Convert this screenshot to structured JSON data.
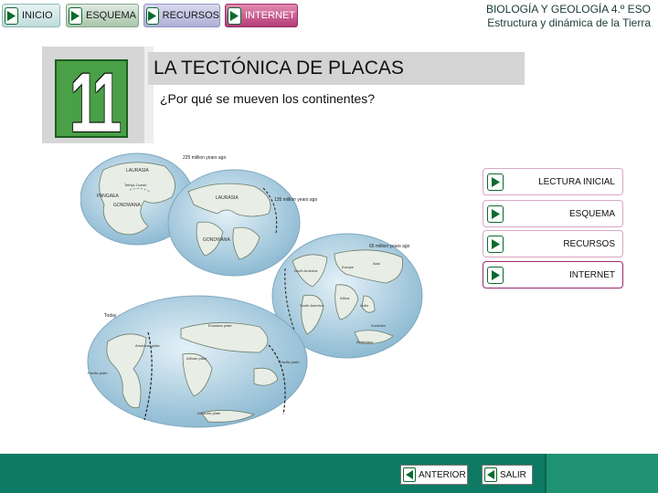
{
  "topnav": {
    "inicio": "INICIO",
    "esquema": "ESQUEMA",
    "recursos": "RECURSOS",
    "internet": "INTERNET"
  },
  "header": {
    "line1": "BIOLOGÍA Y GEOLOGÍA 4.º ESO",
    "line2": "Estructura y dinámica de la Tierra"
  },
  "chapter": {
    "number": "11"
  },
  "main": {
    "title": "LA TECTÓNICA DE PLACAS",
    "subtitle": "¿Por qué se mueven los continentes?"
  },
  "figure": {
    "labels": {
      "t1": "225 million years ago",
      "t2": "135 million years ago",
      "t3": "65 million years ago",
      "t4": "Today",
      "laurasia": "LAURASIA",
      "gondwana": "GONDWANA",
      "pangaea": "PANGAEA",
      "tethys": "Tethys Ocean",
      "north_america": "North America",
      "south_america": "South America",
      "europe": "Europe",
      "asia": "Asia",
      "africa": "Africa",
      "india": "India",
      "australia": "Australia",
      "antarctica": "Antarctica",
      "eurasian": "Eurasian plate",
      "american": "American plate",
      "african": "African plate",
      "pacific_left": "Pacific plate",
      "pacific_right": "Pacific plate",
      "antarctic": "Antarctic plate"
    }
  },
  "side_menu": {
    "lectura": "LECTURA INICIAL",
    "esquema": "ESQUEMA",
    "recursos": "RECURSOS",
    "internet": "INTERNET"
  },
  "footer": {
    "anterior": "ANTERIOR",
    "salir": "SALIR"
  },
  "colors": {
    "accent_green": "#0a6b2e",
    "footer_teal": "#0e7a63",
    "internet_magenta": "#b43d78"
  }
}
